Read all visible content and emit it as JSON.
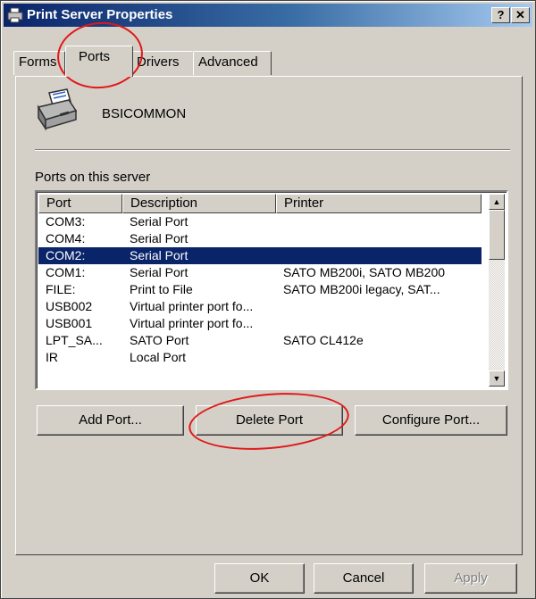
{
  "window": {
    "title": "Print Server Properties",
    "help_label": "?",
    "close_label": "✕"
  },
  "tabs": [
    {
      "label": "Forms"
    },
    {
      "label": "Ports"
    },
    {
      "label": "Drivers"
    },
    {
      "label": "Advanced"
    }
  ],
  "server": {
    "name": "BSICOMMON"
  },
  "ports_section": {
    "label": "Ports on this server",
    "columns": [
      "Port",
      "Description",
      "Printer"
    ],
    "rows": [
      {
        "port": "COM3:",
        "description": "Serial Port",
        "printer": ""
      },
      {
        "port": "COM4:",
        "description": "Serial Port",
        "printer": ""
      },
      {
        "port": "COM2:",
        "description": "Serial Port",
        "printer": ""
      },
      {
        "port": "COM1:",
        "description": "Serial Port",
        "printer": "SATO MB200i, SATO MB200"
      },
      {
        "port": "FILE:",
        "description": "Print to File",
        "printer": "SATO MB200i legacy, SAT..."
      },
      {
        "port": "USB002",
        "description": "Virtual printer port fo...",
        "printer": ""
      },
      {
        "port": "USB001",
        "description": "Virtual printer port fo...",
        "printer": ""
      },
      {
        "port": "LPT_SA...",
        "description": "SATO Port",
        "printer": "SATO CL412e"
      },
      {
        "port": "IR",
        "description": "Local Port",
        "printer": ""
      }
    ],
    "selected_row": 2
  },
  "actions": {
    "add_port": "Add Port...",
    "delete_port": "Delete Port",
    "configure_port": "Configure Port..."
  },
  "dialog_buttons": {
    "ok": "OK",
    "cancel": "Cancel",
    "apply": "Apply"
  },
  "colors": {
    "title_bar": "#0a246a",
    "selection": "#0a246a",
    "annotation_circle": "#e01818",
    "dialog_face": "#d4d0c8"
  }
}
